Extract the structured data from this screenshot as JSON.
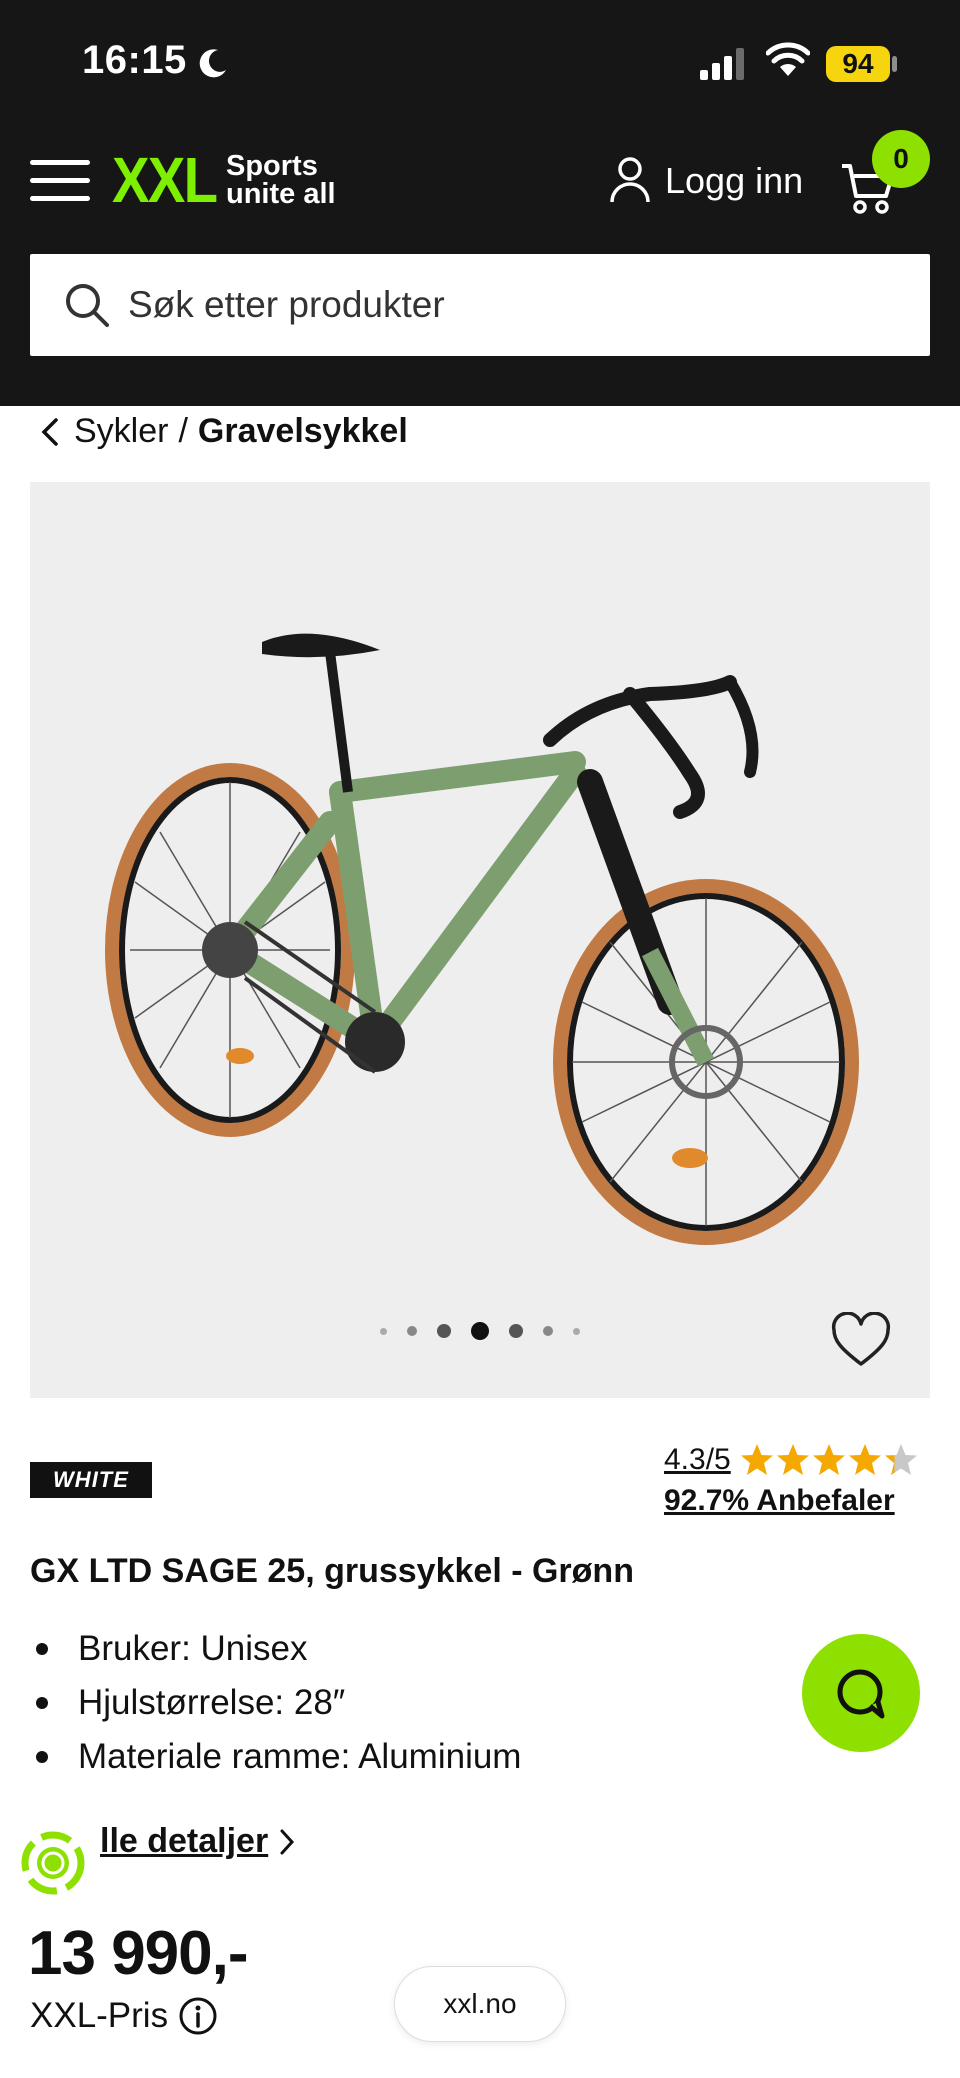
{
  "status_bar": {
    "time": "16:15",
    "battery": "94"
  },
  "header": {
    "logo": "XXL",
    "tagline_line1": "Sports",
    "tagline_line2": "unite all",
    "login_label": "Logg inn",
    "cart_count": "0"
  },
  "search": {
    "placeholder": "Søk etter produkter"
  },
  "breadcrumb": {
    "parent": "Sykler",
    "separator": "/",
    "current": "Gravelsykkel"
  },
  "gallery": {
    "total_images": 7,
    "active_index": 3
  },
  "product": {
    "brand": "WHITE",
    "rating": "4.3/5",
    "rating_value": 4.3,
    "rating_max": 5,
    "recommend": "92.7% Anbefaler",
    "title": "GX LTD SAGE 25, grussykkel - Grønn",
    "specs": [
      "Bruker: Unisex",
      "Hjulstørrelse: 28″",
      "Materiale ramme: Aluminium"
    ],
    "details_link": "lle detaljer",
    "price": "13 990,-",
    "price_label": "XXL-Pris"
  },
  "browser": {
    "url": "xxl.no"
  },
  "colors": {
    "accent": "#8ee000",
    "header_bg": "#161616",
    "star": "#f5a800"
  },
  "icons": [
    "moon-icon",
    "signal-icon",
    "wifi-icon",
    "menu-icon",
    "user-icon",
    "cart-icon",
    "search-icon",
    "chevron-left-icon",
    "heart-icon",
    "star-icon",
    "chat-icon",
    "chevron-right-icon",
    "info-icon",
    "loader-icon"
  ]
}
